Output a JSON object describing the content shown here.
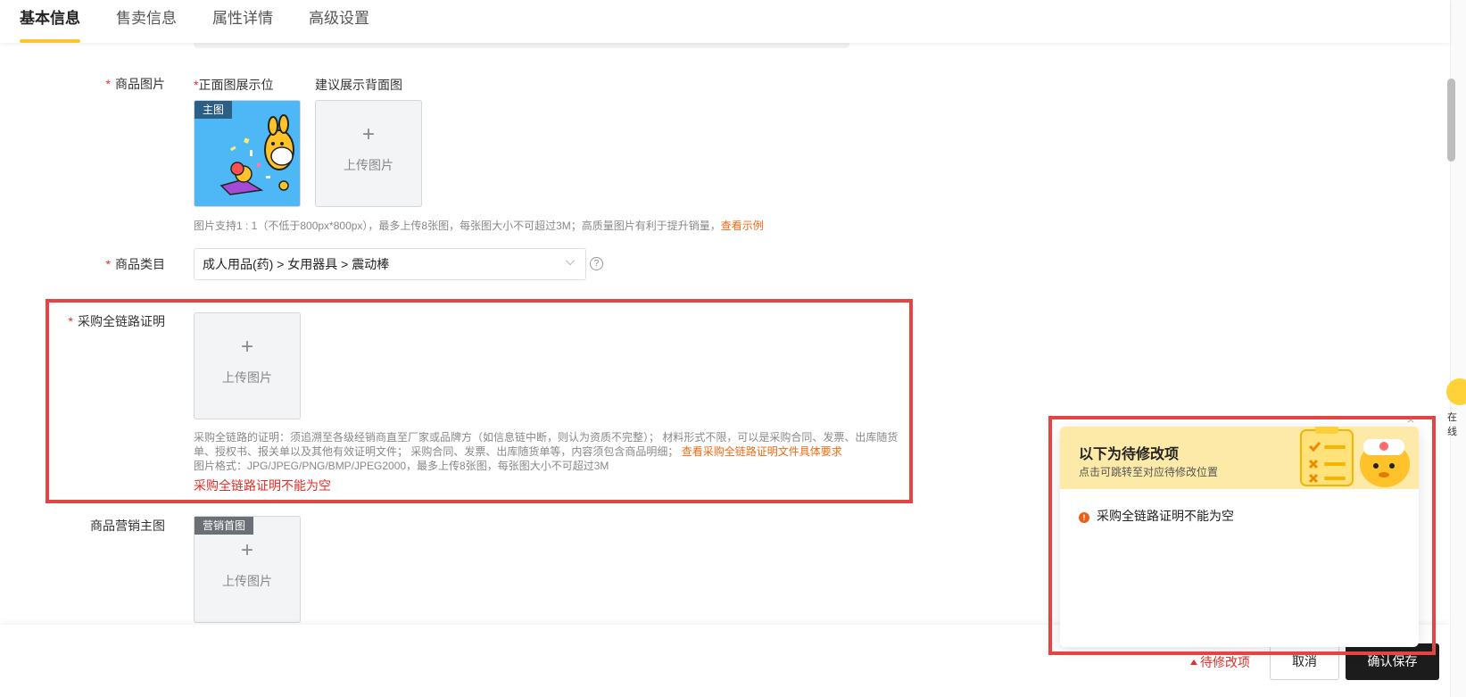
{
  "tabs": [
    {
      "label": "基本信息",
      "active": true
    },
    {
      "label": "售卖信息",
      "active": false
    },
    {
      "label": "属性详情",
      "active": false
    },
    {
      "label": "高级设置",
      "active": false
    }
  ],
  "product_image": {
    "label": "商品图片",
    "required_mark": "*",
    "front_label": "正面图展示位",
    "back_label": "建议展示背面图",
    "main_badge": "主图",
    "upload_plus": "+",
    "upload_text": "上传图片",
    "hint": "图片支持1 : 1（不低于800px*800px），最多上传8张图，每张图大小不可超过3M；高质量图片有利于提升销量，",
    "hint_link": "查看示例"
  },
  "category": {
    "label": "商品类目",
    "required_mark": "*",
    "value": "成人用品(药) > 女用器具 > 震动棒",
    "help": "?"
  },
  "purchase_proof": {
    "label": "采购全链路证明",
    "required_mark": "*",
    "upload_plus": "+",
    "upload_text": "上传图片",
    "desc_line1": "采购全链路的证明：须追溯至各级经销商直至厂家或品牌方（如信息链中断，则认为资质不完整）； 材料形式不限，可以是采购合同、发票、出库随货",
    "desc_line2": "单、授权书、报关单以及其他有效证明文件；  采购合同、发票、出库随货单等，内容须包含商品明细；",
    "desc_link": "查看采购全链路证明文件具体要求",
    "desc_line3": "图片格式：JPG/JPEG/PNG/BMP/JPEG2000，最多上传8张图，每张图大小不可超过3M",
    "error": "采购全链路证明不能为空"
  },
  "marketing_image": {
    "label": "商品营销主图",
    "badge": "营销首图",
    "upload_plus": "+",
    "upload_text": "上传图片"
  },
  "bottom_bar": {
    "pending_link": "待修改项",
    "cancel": "取消",
    "save": "确认保存"
  },
  "assistant": {
    "text": "在线"
  },
  "pending_panel": {
    "title": "以下为待修改项",
    "subtitle": "点击可跳转至对应待修改位置",
    "close": "×",
    "items": [
      "采购全链路证明不能为空"
    ]
  },
  "colors": {
    "accent": "#ffc42e",
    "error": "#e5302a",
    "link": "#f26a12",
    "primary_button": "#1c1c1c",
    "highlight_box": "#e64444"
  }
}
